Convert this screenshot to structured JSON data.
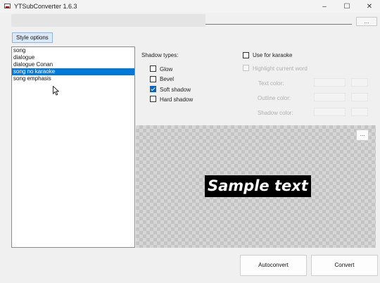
{
  "window": {
    "title": "YTSubConverter 1.6.3",
    "minimize_glyph": "–",
    "maximize_glyph": "☐",
    "close_glyph": "✕"
  },
  "topbar": {
    "browse_label": "..."
  },
  "tabs": [
    {
      "label": "Style options"
    }
  ],
  "styles_list": {
    "items": [
      {
        "label": "song",
        "selected": false
      },
      {
        "label": "dialogue",
        "selected": false
      },
      {
        "label": "dialogue Conan",
        "selected": false
      },
      {
        "label": "song no karaoke",
        "selected": true
      },
      {
        "label": "song emphasis",
        "selected": false
      }
    ]
  },
  "shadow": {
    "heading": "Shadow types:",
    "options": [
      {
        "label": "Glow",
        "checked": false
      },
      {
        "label": "Bevel",
        "checked": false
      },
      {
        "label": "Soft shadow",
        "checked": true
      },
      {
        "label": "Hard shadow",
        "checked": false
      }
    ]
  },
  "karaoke": {
    "use_label": "Use for karaoke",
    "highlight_label": "Highlight current word",
    "text_color_label": "Text color:",
    "outline_color_label": "Outline color:",
    "shadow_color_label": "Shadow color:"
  },
  "preview": {
    "button_label": "...",
    "sample_text": "Sample text"
  },
  "footer": {
    "autoconvert_label": "Autoconvert",
    "convert_label": "Convert"
  }
}
